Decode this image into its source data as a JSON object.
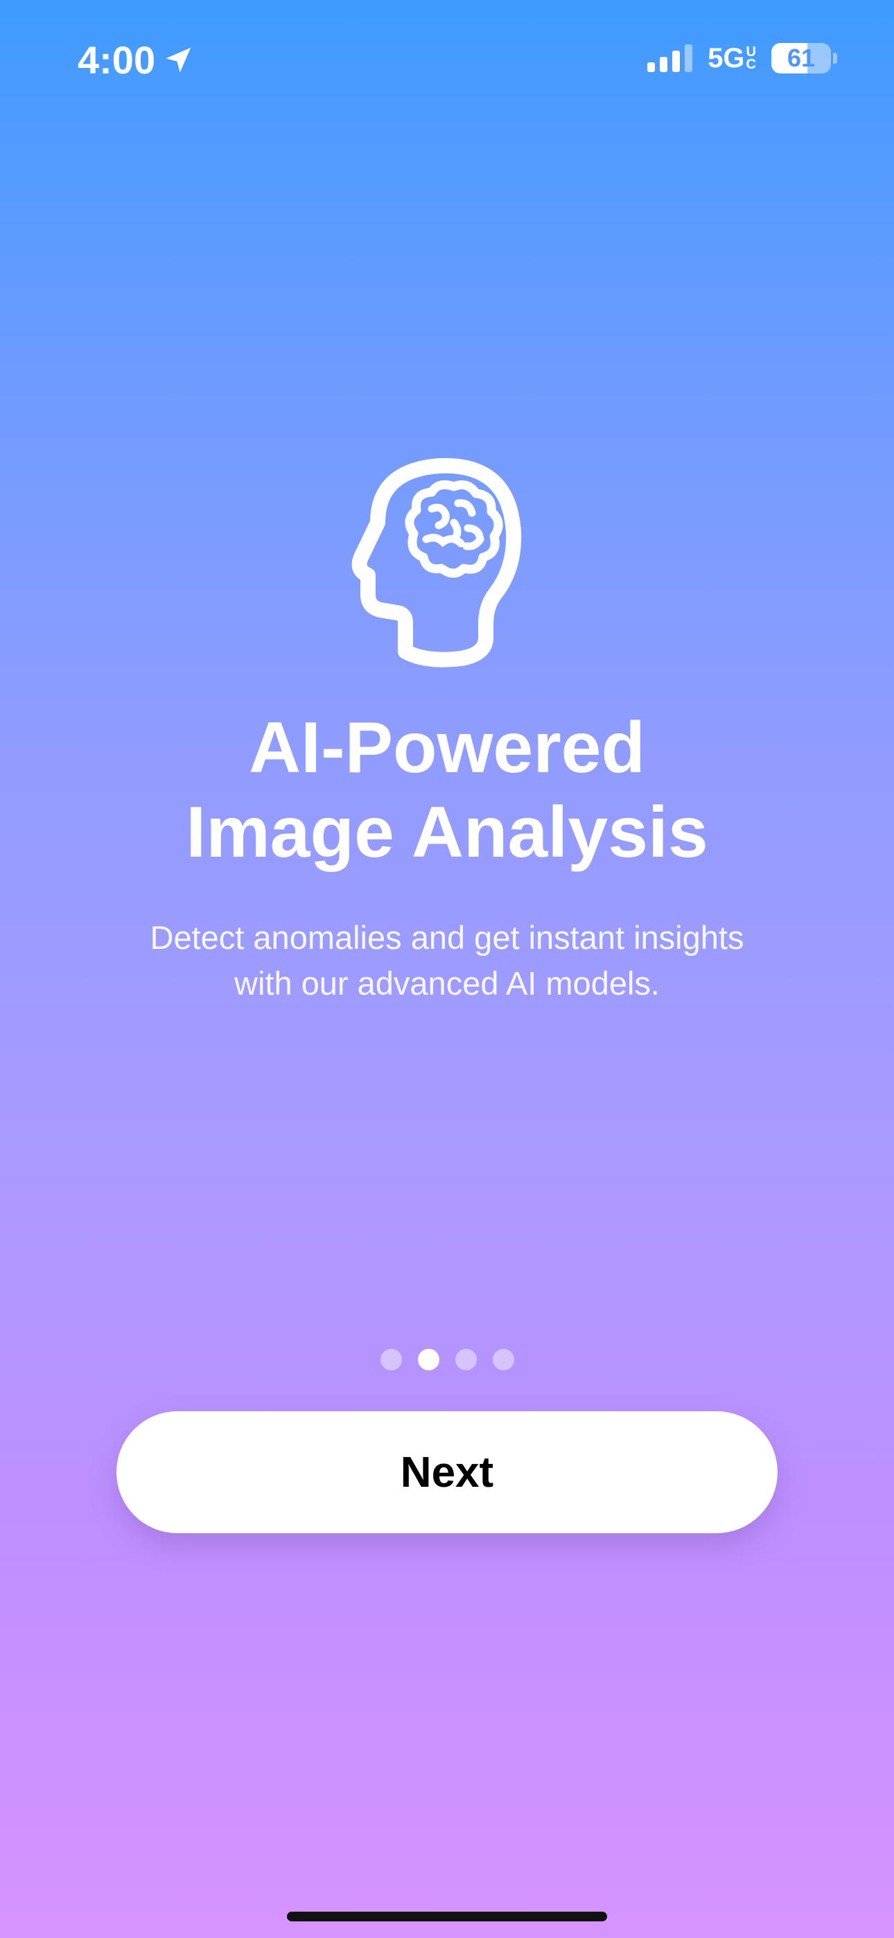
{
  "status_bar": {
    "time": "4:00",
    "network": "5G",
    "network_sup": "U",
    "network_sub": "C",
    "battery_level": "61",
    "battery_fraction": 0.61,
    "signal_bars_filled": 3,
    "signal_bars_total": 4
  },
  "onboarding": {
    "icon": "brain-head-icon",
    "title_line1": "AI-Powered",
    "title_line2": "Image Analysis",
    "subtitle_line1": "Detect anomalies and get instant insights",
    "subtitle_line2": "with our advanced AI models.",
    "page_count": 4,
    "current_page_index": 1,
    "next_label": "Next"
  },
  "colors": {
    "gradient_top": "#3f9bff",
    "gradient_bottom": "#d694ff",
    "button_bg": "#ffffff",
    "button_text": "#000000"
  }
}
